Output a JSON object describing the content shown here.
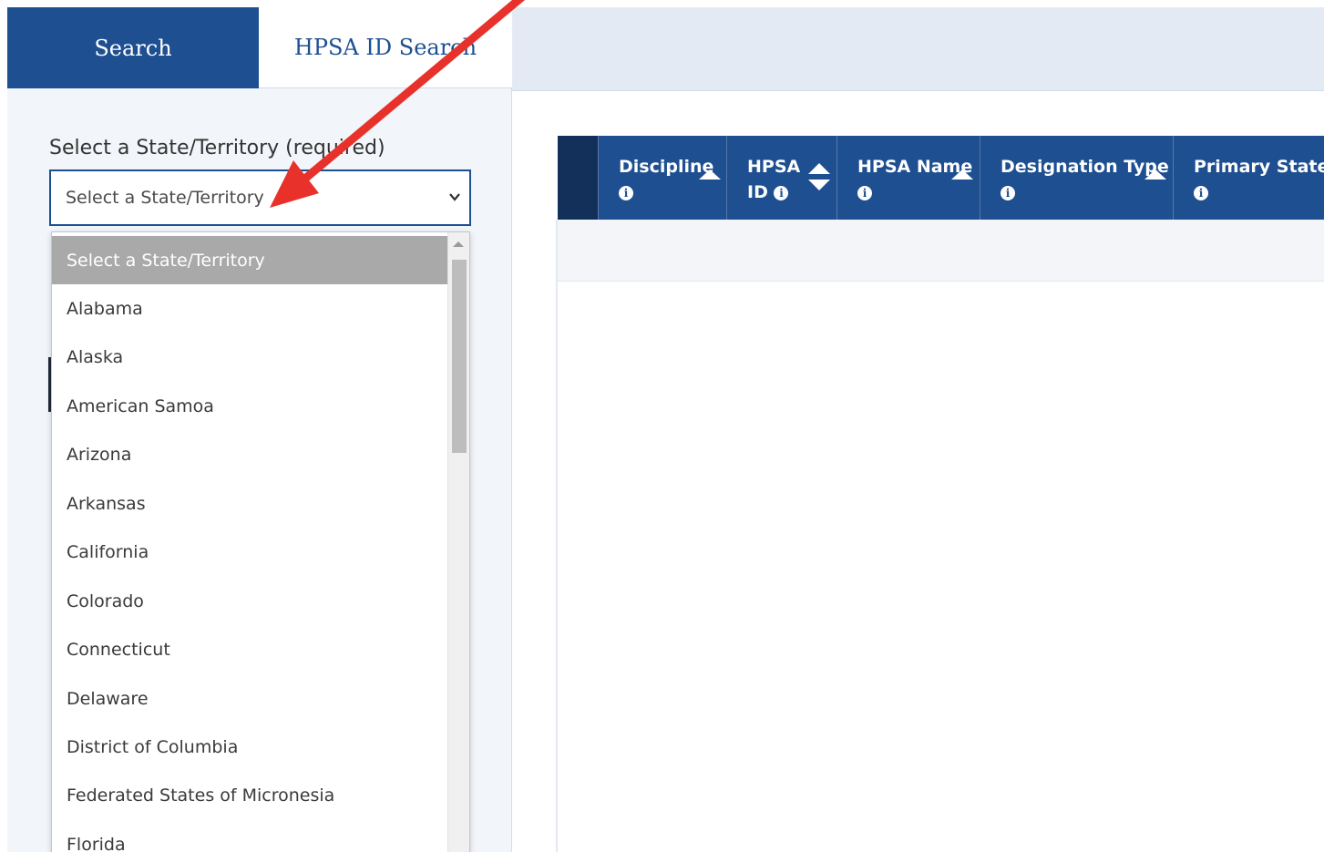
{
  "tabs": {
    "search": "Search",
    "hpsa_id_search": "HPSA ID Search"
  },
  "form": {
    "state_label": "Select a State/Territory (required)",
    "state_select_value": "Select a State/Territory"
  },
  "dropdown": {
    "options": [
      "Select a State/Territory",
      "Alabama",
      "Alaska",
      "American Samoa",
      "Arizona",
      "Arkansas",
      "California",
      "Colorado",
      "Connecticut",
      "Delaware",
      "District of Columbia",
      "Federated States of Micronesia",
      "Florida"
    ]
  },
  "table": {
    "columns": {
      "discipline": "Discipline",
      "hpsa_id_line1": "HPSA",
      "hpsa_id_line2": "ID",
      "hpsa_name": "HPSA Name",
      "designation_type": "Designation Type",
      "primary_state": "Primary State"
    }
  },
  "colors": {
    "primary_blue": "#1d4f91",
    "dark_blue": "#13305a",
    "annotation_red": "#e8312a"
  },
  "icons": [
    "info-icon",
    "sort-up-icon",
    "sort-both-icon",
    "chevron-down-icon",
    "red-arrow-annotation"
  ]
}
